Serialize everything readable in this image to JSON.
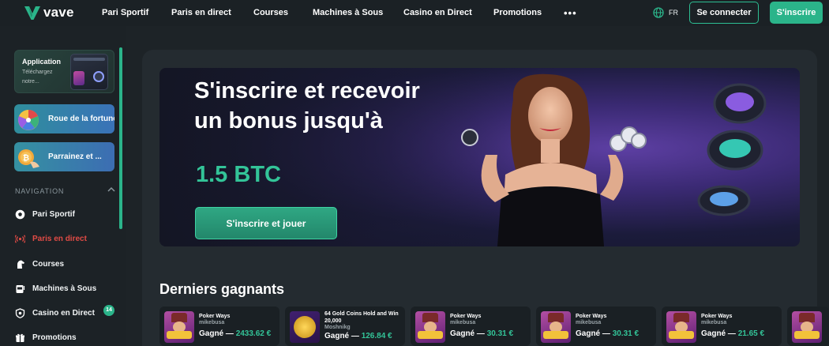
{
  "brand": {
    "name": "vave",
    "accent": "#2bb48a",
    "live_color": "#e14b45"
  },
  "topnav": {
    "items": [
      "Pari Sportif",
      "Paris en direct",
      "Courses",
      "Machines à Sous",
      "Casino en Direct",
      "Promotions"
    ],
    "more_label": "•••",
    "language": "FR",
    "login_label": "Se connecter",
    "signup_label": "S'inscrire"
  },
  "sidebar": {
    "app_promo": {
      "title": "Application",
      "subtitle": "Téléchargez notre..."
    },
    "promos": [
      "Roue de la fortune",
      "Parrainez et ..."
    ],
    "nav_title": "NAVIGATION",
    "items": [
      {
        "label": "Pari Sportif",
        "icon": "soccer-ball-icon"
      },
      {
        "label": "Paris en direct",
        "icon": "live-signal-icon"
      },
      {
        "label": "Courses",
        "icon": "horse-icon"
      },
      {
        "label": "Machines à Sous",
        "icon": "slot-machine-icon"
      },
      {
        "label": "Casino en Direct",
        "icon": "poker-chip-icon"
      },
      {
        "label": "Promotions",
        "icon": "gift-icon"
      }
    ],
    "promotions_badge": "14"
  },
  "hero": {
    "title": "S'inscrire et recevoir un bonus jusqu'à",
    "amount": "1.5 BTC",
    "cta_label": "S'inscrire et jouer"
  },
  "winners": {
    "title": "Derniers gagnants",
    "won_label": "Gagné",
    "items": [
      {
        "game": "Poker Ways",
        "user": "mikebusa",
        "amount": "2433.62 €"
      },
      {
        "game": "64 Gold Coins Hold and Win 20,000",
        "user": "Moshnikg",
        "amount": "126.84 €"
      },
      {
        "game": "Poker Ways",
        "user": "mikebusa",
        "amount": "30.31 €"
      },
      {
        "game": "Poker Ways",
        "user": "mikebusa",
        "amount": "30.31 €"
      },
      {
        "game": "Poker Ways",
        "user": "mikebusa",
        "amount": "21.65 €"
      }
    ]
  }
}
